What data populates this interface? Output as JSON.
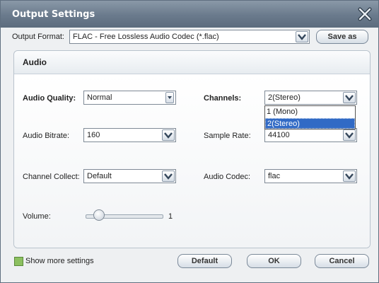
{
  "window": {
    "title": "Output Settings"
  },
  "output_format": {
    "label": "Output Format:",
    "value": "FLAC - Free Lossless Audio Codec (*.flac)",
    "save_as_label": "Save as"
  },
  "audio_panel": {
    "title": "Audio",
    "audio_quality": {
      "label": "Audio Quality:",
      "value": "Normal"
    },
    "channels": {
      "label": "Channels:",
      "value": "2(Stereo)",
      "options": [
        "1 (Mono)",
        "2(Stereo)"
      ]
    },
    "audio_bitrate": {
      "label": "Audio Bitrate:",
      "value": "160"
    },
    "sample_rate": {
      "label": "Sample Rate:",
      "value": "44100"
    },
    "channel_collect": {
      "label": "Channel Collect:",
      "value": "Default"
    },
    "audio_codec": {
      "label": "Audio Codec:",
      "value": "flac"
    },
    "volume": {
      "label": "Volume:",
      "value": "1"
    }
  },
  "footer": {
    "show_more_label": "Show more settings",
    "default_label": "Default",
    "ok_label": "OK",
    "cancel_label": "Cancel"
  }
}
